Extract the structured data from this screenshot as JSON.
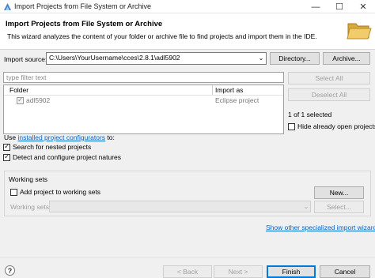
{
  "window": {
    "title": "Import Projects from File System or Archive",
    "controls": {
      "minimize": "—",
      "maximize": "☐",
      "close": "✕"
    }
  },
  "header": {
    "title": "Import Projects from File System or Archive",
    "description": "This wizard analyzes the content of your folder or archive file to find projects and import them in the IDE."
  },
  "source": {
    "label": "Import source:",
    "value": "C:\\Users\\YourUsername\\cces\\2.8.1\\adl5902",
    "directory_button": "Directory...",
    "archive_button": "Archive..."
  },
  "filter": {
    "placeholder": "type filter text"
  },
  "table": {
    "columns": [
      "Folder",
      "Import as"
    ],
    "rows": [
      {
        "folder": "adl5902",
        "import_as": "Eclipse project",
        "checked": true
      }
    ]
  },
  "side": {
    "select_all": "Select All",
    "deselect_all": "Deselect All",
    "selected_count": "1 of 1 selected",
    "hide_open": "Hide already open projects"
  },
  "options": {
    "use_prefix": "Use ",
    "use_link": "installed project configurators",
    "use_suffix": " to:",
    "search_nested": "Search for nested projects",
    "detect_natures": "Detect and configure project natures"
  },
  "working_sets": {
    "group_label": "Working sets",
    "add_label": "Add project to working sets",
    "new_button": "New...",
    "sets_label": "Working sets:",
    "select_button": "Select..."
  },
  "specialized_link": "Show other specialized import wizards",
  "footer": {
    "help": "?",
    "back": "< Back",
    "next": "Next >",
    "finish": "Finish",
    "cancel": "Cancel"
  },
  "colors": {
    "link": "#0066cc",
    "accent": "#0078d7"
  }
}
